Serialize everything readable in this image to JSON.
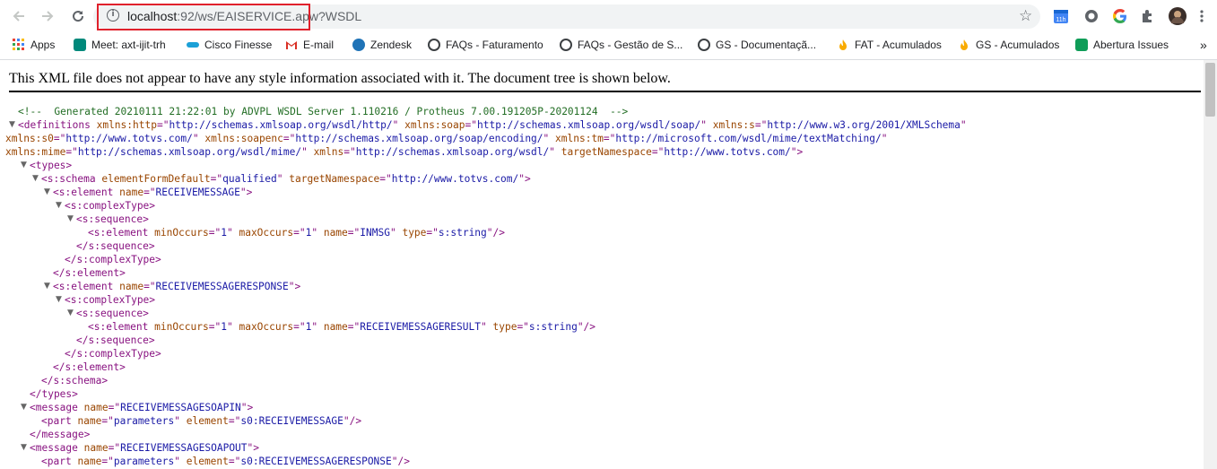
{
  "browser": {
    "url_host": "localhost",
    "url_path": ":92/ws/EAISERVICE.apw",
    "url_query": "?WSDL"
  },
  "bookmarks": [
    {
      "label": "Apps",
      "icon": "apps-grid-icon",
      "color": "#ea4335"
    },
    {
      "label": "Meet: axt-ijit-trh",
      "icon": "google-meet-icon",
      "color": "#00897b"
    },
    {
      "label": "Cisco Finesse",
      "icon": "cisco-icon",
      "color": "#1ba0d7"
    },
    {
      "label": "E-mail",
      "icon": "gmail-icon",
      "color": "#d93025"
    },
    {
      "label": "Zendesk",
      "icon": "zendesk-icon",
      "color": "#1f73b7"
    },
    {
      "label": "FAQs - Faturamento",
      "icon": "faq-icon",
      "color": "#3c4043"
    },
    {
      "label": "FAQs - Gestão de S...",
      "icon": "faq-icon",
      "color": "#3c4043"
    },
    {
      "label": "GS - Documentaçã...",
      "icon": "faq-icon",
      "color": "#3c4043"
    },
    {
      "label": "FAT - Acumulados",
      "icon": "flame-icon",
      "color": "#f9ab00"
    },
    {
      "label": "GS - Acumulados",
      "icon": "flame-icon",
      "color": "#f9ab00"
    },
    {
      "label": "Abertura Issues",
      "icon": "sheets-icon",
      "color": "#0f9d58"
    }
  ],
  "notice": "This XML file does not appear to have any style information associated with it. The document tree is shown below.",
  "xml": {
    "comment": "<!--  Generated 20210111 21:22:01 by ADVPL WSDL Server 1.110216 / Protheus 7.00.191205P-20201124  -->",
    "definitions_open": "definitions",
    "ns_http": "http://schemas.xmlsoap.org/wsdl/http/",
    "ns_soap": "http://schemas.xmlsoap.org/wsdl/soap/",
    "ns_s": "http://www.w3.org/2001/XMLSchema",
    "ns_s0": "http://www.totvs.com/",
    "ns_soapenc": "http://schemas.xmlsoap.org/soap/encoding/",
    "ns_tm": "http://microsoft.com/wsdl/mime/textMatching/",
    "ns_mime": "http://schemas.xmlsoap.org/wsdl/mime/",
    "ns_default": "http://schemas.xmlsoap.org/wsdl/",
    "target_namespace": "http://www.totvs.com/",
    "element_form_default": "qualified",
    "element1_name": "RECEIVEMESSAGE",
    "element1_inner_name": "INMSG",
    "element2_name": "RECEIVEMESSAGERESPONSE",
    "element2_inner_name": "RECEIVEMESSAGERESULT",
    "min_occurs": "1",
    "max_occurs": "1",
    "type_string": "s:string",
    "message1_name": "RECEIVEMESSAGESOAPIN",
    "message1_part_element": "s0:RECEIVEMESSAGE",
    "message2_name": "RECEIVEMESSAGESOAPOUT",
    "message2_part_element": "s0:RECEIVEMESSAGERESPONSE",
    "part_name": "parameters"
  }
}
